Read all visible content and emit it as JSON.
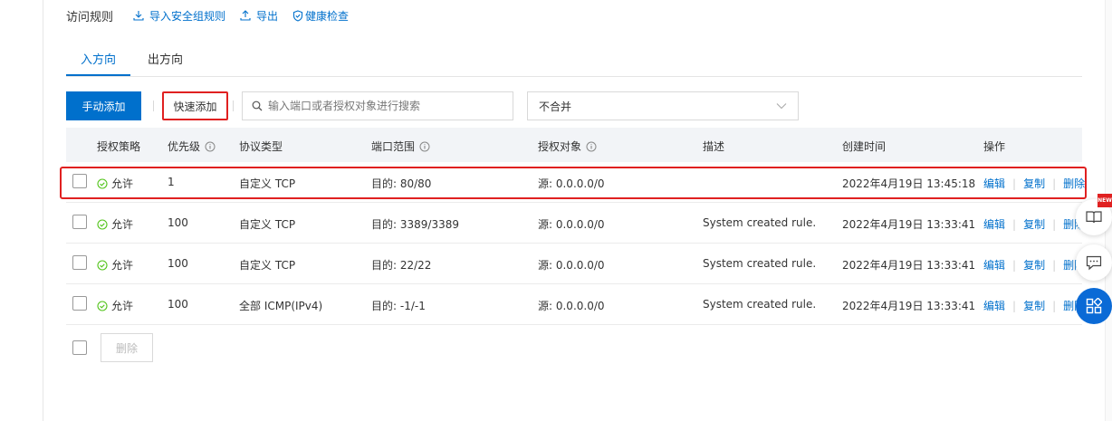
{
  "header": {
    "title": "访问规则",
    "import_label": "导入安全组规则",
    "export_label": "导出",
    "health_label": "健康检查"
  },
  "tabs": [
    {
      "label": "入方向",
      "active": true
    },
    {
      "label": "出方向",
      "active": false
    }
  ],
  "toolbar": {
    "add_label": "手动添加",
    "quick_add_label": "快速添加",
    "search_placeholder": "输入端口或者授权对象进行搜索",
    "merge_select": "不合并"
  },
  "table": {
    "headers": {
      "policy": "授权策略",
      "priority": "优先级",
      "protocol": "协议类型",
      "port": "端口范围",
      "object": "授权对象",
      "desc": "描述",
      "created": "创建时间",
      "ops": "操作"
    },
    "rows": [
      {
        "policy": "允许",
        "priority": "1",
        "protocol": "自定义 TCP",
        "port": "目的: 80/80",
        "object": "源: 0.0.0.0/0",
        "desc": "",
        "created": "2022年4月19日 13:45:18"
      },
      {
        "policy": "允许",
        "priority": "100",
        "protocol": "自定义 TCP",
        "port": "目的: 3389/3389",
        "object": "源: 0.0.0.0/0",
        "desc": "System created rule.",
        "created": "2022年4月19日 13:33:41"
      },
      {
        "policy": "允许",
        "priority": "100",
        "protocol": "自定义 TCP",
        "port": "目的: 22/22",
        "object": "源: 0.0.0.0/0",
        "desc": "System created rule.",
        "created": "2022年4月19日 13:33:41"
      },
      {
        "policy": "允许",
        "priority": "100",
        "protocol": "全部 ICMP(IPv4)",
        "port": "目的: -1/-1",
        "object": "源: 0.0.0.0/0",
        "desc": "System created rule.",
        "created": "2022年4月19日 13:33:41"
      }
    ],
    "op_labels": {
      "edit": "编辑",
      "copy": "复制",
      "delete": "删除"
    }
  },
  "footer": {
    "delete_label": "删除"
  },
  "side": {
    "new_badge": "NEW"
  },
  "colors": {
    "accent": "#0070cc",
    "highlight": "#e02020",
    "success": "#52c41a"
  }
}
